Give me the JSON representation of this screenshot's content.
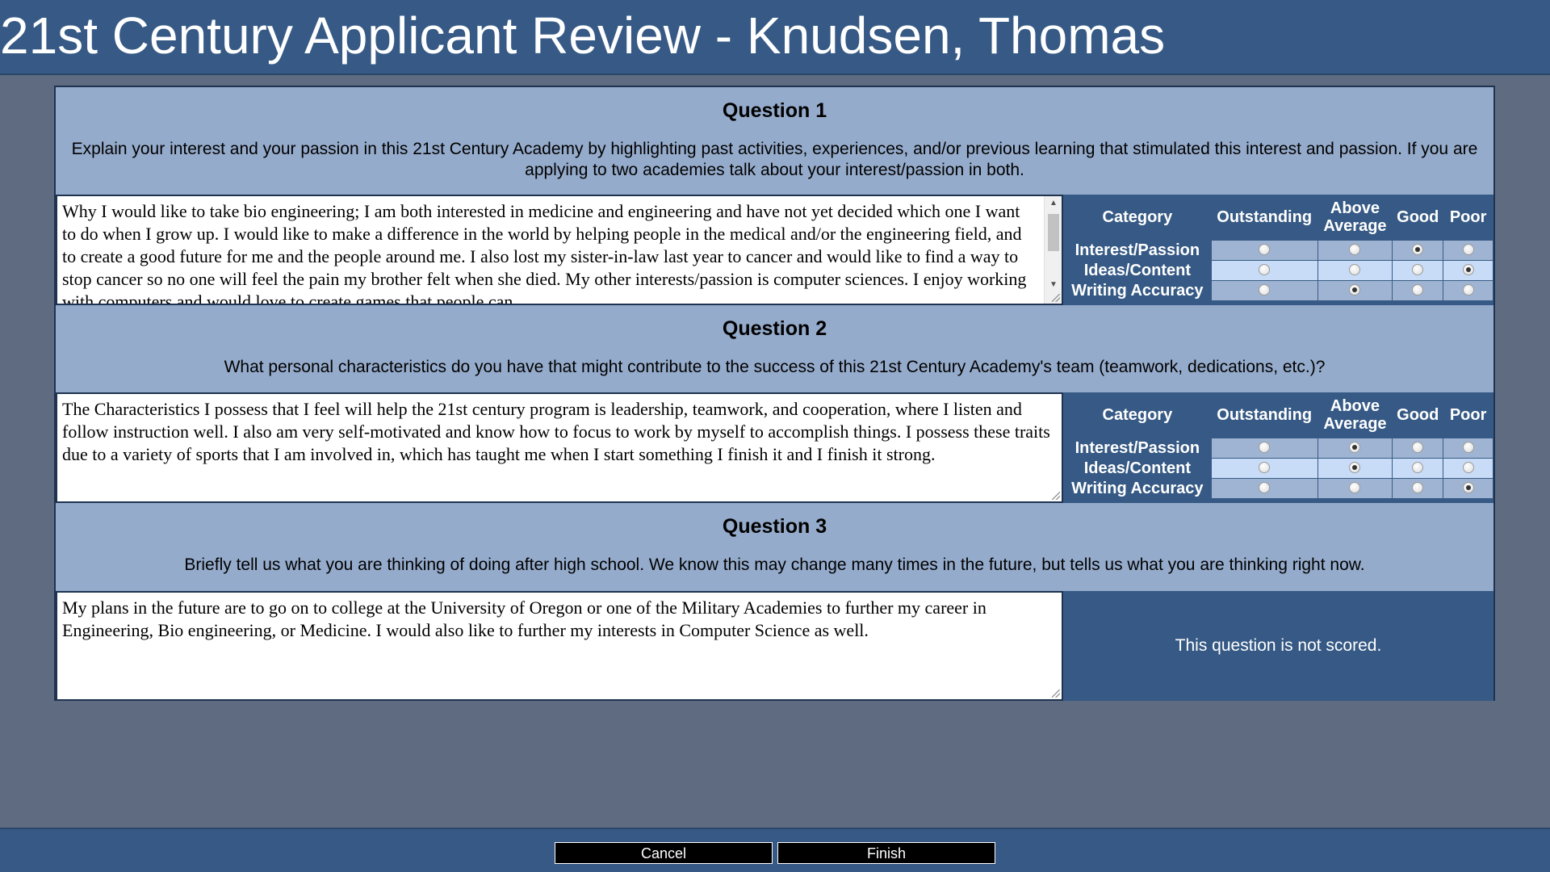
{
  "header": {
    "title": "21st Century Applicant Review - Knudsen, Thomas"
  },
  "score_labels": {
    "category": "Category",
    "outstanding": "Outstanding",
    "above_average_line1": "Above",
    "above_average_line2": "Average",
    "good": "Good",
    "poor": "Poor",
    "rows": [
      "Interest/Passion",
      "Ideas/Content",
      "Writing Accuracy"
    ]
  },
  "questions": [
    {
      "title": "Question 1",
      "prompt": "Explain your interest and your passion in this 21st Century Academy by highlighting past activities, experiences, and/or previous learning that stimulated this interest and passion. If you are applying to two academies talk about your interest/passion in both.",
      "answer": "Why I would like to take bio engineering; I am both interested in medicine and engineering and have not yet decided which one I want to do when I grow up. I would like to make a difference in the world by helping people in the medical and/or the engineering field, and to create a good future for me and the people around me. I also lost my sister-in-law last year to cancer and would like to find a way to stop cancer so no one will feel the pain my brother felt when she died.  My other interests/passion is computer sciences. I enjoy working with computers and would love to create games that people can",
      "scores": {
        "Interest/Passion": "Good",
        "Ideas/Content": "Poor",
        "Writing Accuracy": "Above Average"
      }
    },
    {
      "title": "Question 2",
      "prompt": "What personal characteristics do you have that might contribute to the success of this 21st Century Academy's team (teamwork, dedications, etc.)?",
      "answer": "The Characteristics I possess that I feel will help the 21st century program is leadership, teamwork, and cooperation, where I listen and follow instruction well. I also am very self-motivated and know how to focus to work by myself to accomplish things. I possess these traits due to a variety of sports that I am involved in, which has taught me when I start something I finish it and I finish it strong.",
      "scores": {
        "Interest/Passion": "Above Average",
        "Ideas/Content": "Above Average",
        "Writing Accuracy": "Poor"
      }
    },
    {
      "title": "Question 3",
      "prompt": "Briefly tell us what you are thinking of doing after high school. We know this may change many times in the future, but tells us what you are thinking right now.",
      "answer": "My plans in the future are to go on to college at the University of Oregon or one of the Military Academies to further my career in Engineering, Bio engineering, or Medicine. I would also like to further my interests in Computer Science as well.",
      "not_scored_text": "This question is not scored."
    }
  ],
  "footer": {
    "cancel_label": "Cancel",
    "finish_label": "Finish"
  }
}
